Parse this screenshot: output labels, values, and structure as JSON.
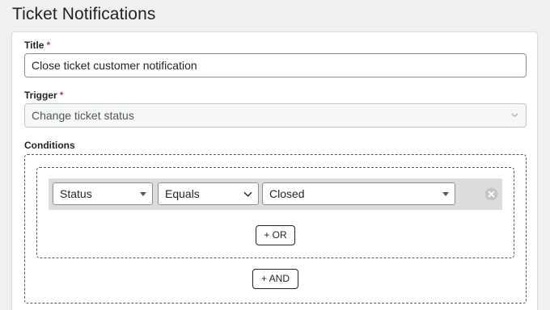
{
  "page": {
    "title": "Ticket Notifications"
  },
  "form": {
    "title_field": {
      "label": "Title",
      "required_mark": "*",
      "value": "Close ticket customer notification"
    },
    "trigger_field": {
      "label": "Trigger",
      "required_mark": "*",
      "value": "Change ticket status"
    },
    "conditions": {
      "label": "Conditions",
      "groups": [
        {
          "rows": [
            {
              "field": "Status",
              "operator": "Equals",
              "value": "Closed"
            }
          ],
          "or_button": "+ OR"
        }
      ],
      "and_button": "+ AND"
    }
  },
  "colors": {
    "required": "#d63638",
    "text": "#1d2327",
    "row_bg": "#dcdcde",
    "page_bg": "#f0f0f1"
  },
  "icons": {
    "trigger_dropdown": "chevron-down-icon",
    "remove_condition": "remove-circle-icon"
  }
}
